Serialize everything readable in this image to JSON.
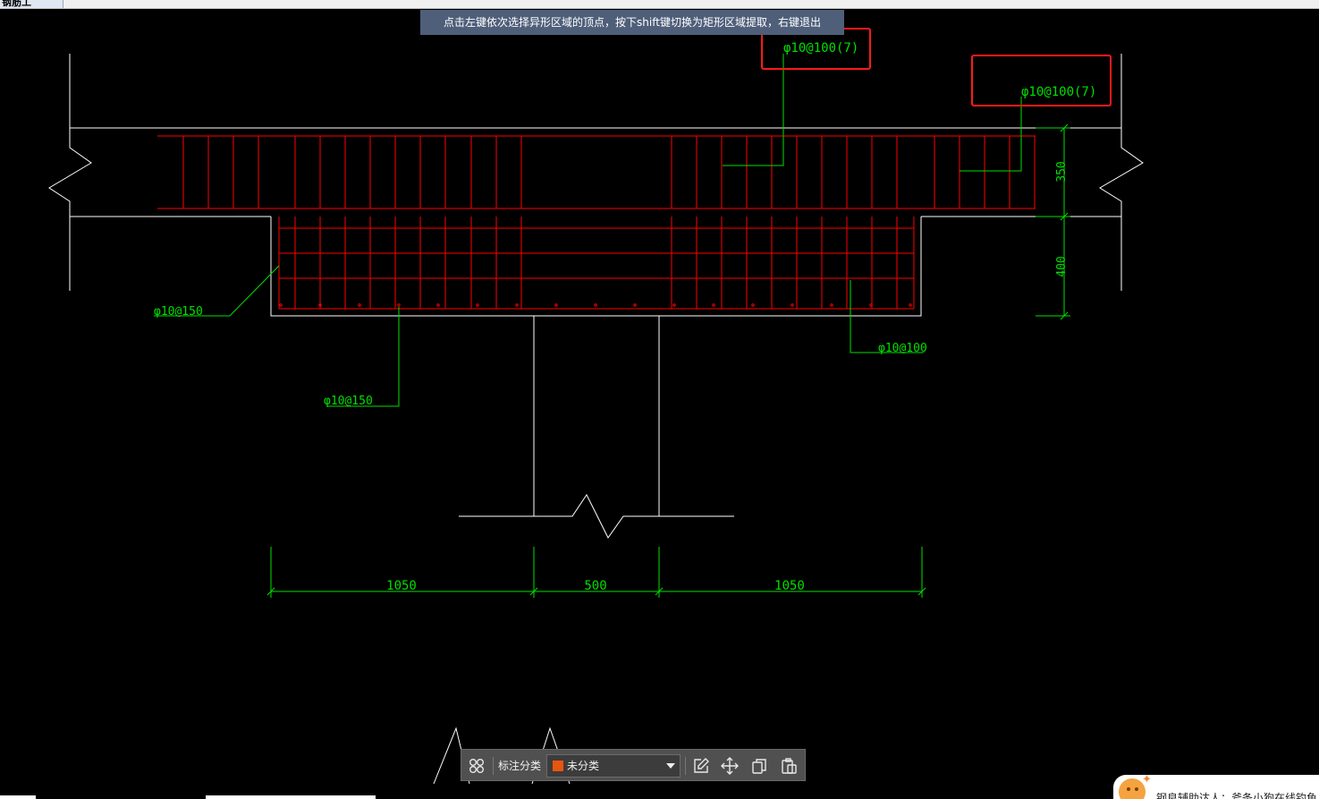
{
  "top_tab": {
    "label": "钢筋工"
  },
  "hint": {
    "text": "点击左键依次选择异形区域的顶点，按下shift键切换为矩形区域提取，右键退出"
  },
  "drawing": {
    "labels": {
      "rebar_top_1": "φ10@100(7)",
      "rebar_top_2": "φ10@100(7)",
      "rebar_left_1": "φ10@150",
      "rebar_left_2": "φ10@150",
      "rebar_right": "φ10@100"
    },
    "dims": {
      "height_top": "350",
      "height_bottom": "400",
      "width_left": "1050",
      "width_mid": "500",
      "width_right": "1050"
    },
    "colors": {
      "concrete": "#ffffff",
      "rebar": "#ff0000",
      "annotation": "#00e000",
      "highlight": "#ff1a1a"
    }
  },
  "toolbar": {
    "category_label": "标注分类",
    "selected_value": "未分类",
    "selected_color": "#e8560e",
    "icons": [
      "grid-icon",
      "edit-icon",
      "move-icon",
      "copy-icon",
      "paste-icon"
    ]
  },
  "assistant": {
    "text": "钢良辅助达人：斧条小狗在线钓鱼"
  }
}
